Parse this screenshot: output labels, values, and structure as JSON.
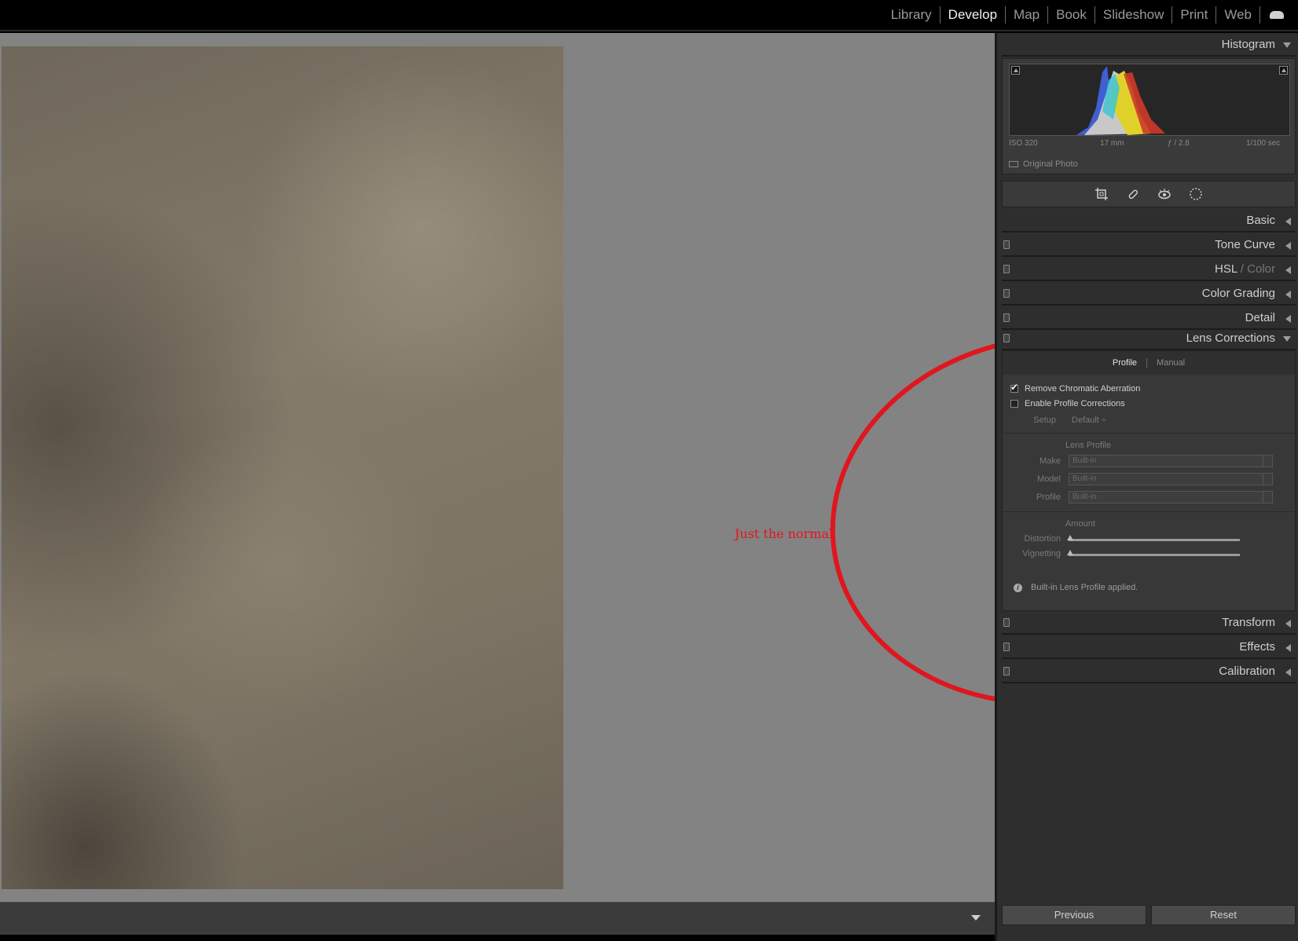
{
  "topbar": {
    "modules": [
      "Library",
      "Develop",
      "Map",
      "Book",
      "Slideshow",
      "Print",
      "Web"
    ],
    "active": "Develop"
  },
  "annotation": {
    "text": "Just the normal",
    "color": "#e0161e"
  },
  "histogram": {
    "title": "Histogram",
    "iso": "ISO 320",
    "focal": "17 mm",
    "aperture": "ƒ / 2.8",
    "shutter": "1/100 sec",
    "original_photo": "Original Photo"
  },
  "sections": {
    "basic": "Basic",
    "tone_curve": "Tone Curve",
    "hsl": "HSL",
    "hsl_sep": " / ",
    "color": "Color",
    "color_grading": "Color Grading",
    "detail": "Detail",
    "lens_corrections": "Lens Corrections",
    "transform": "Transform",
    "effects": "Effects",
    "calibration": "Calibration"
  },
  "lens": {
    "tab_profile": "Profile",
    "tab_manual": "Manual",
    "remove_ca": "Remove Chromatic Aberration",
    "remove_ca_checked": true,
    "enable_profile": "Enable Profile Corrections",
    "enable_profile_checked": false,
    "setup_label": "Setup",
    "setup_value": "Default ÷",
    "lens_profile": "Lens Profile",
    "make_label": "Make",
    "make_value": "Built-in",
    "model_label": "Model",
    "model_value": "Built-in",
    "profile_label": "Profile",
    "profile_value": "Built-in",
    "amount": "Amount",
    "distortion": "Distortion",
    "vignetting": "Vignetting",
    "info": "Built-in Lens Profile applied."
  },
  "buttons": {
    "previous": "Previous",
    "reset": "Reset"
  }
}
